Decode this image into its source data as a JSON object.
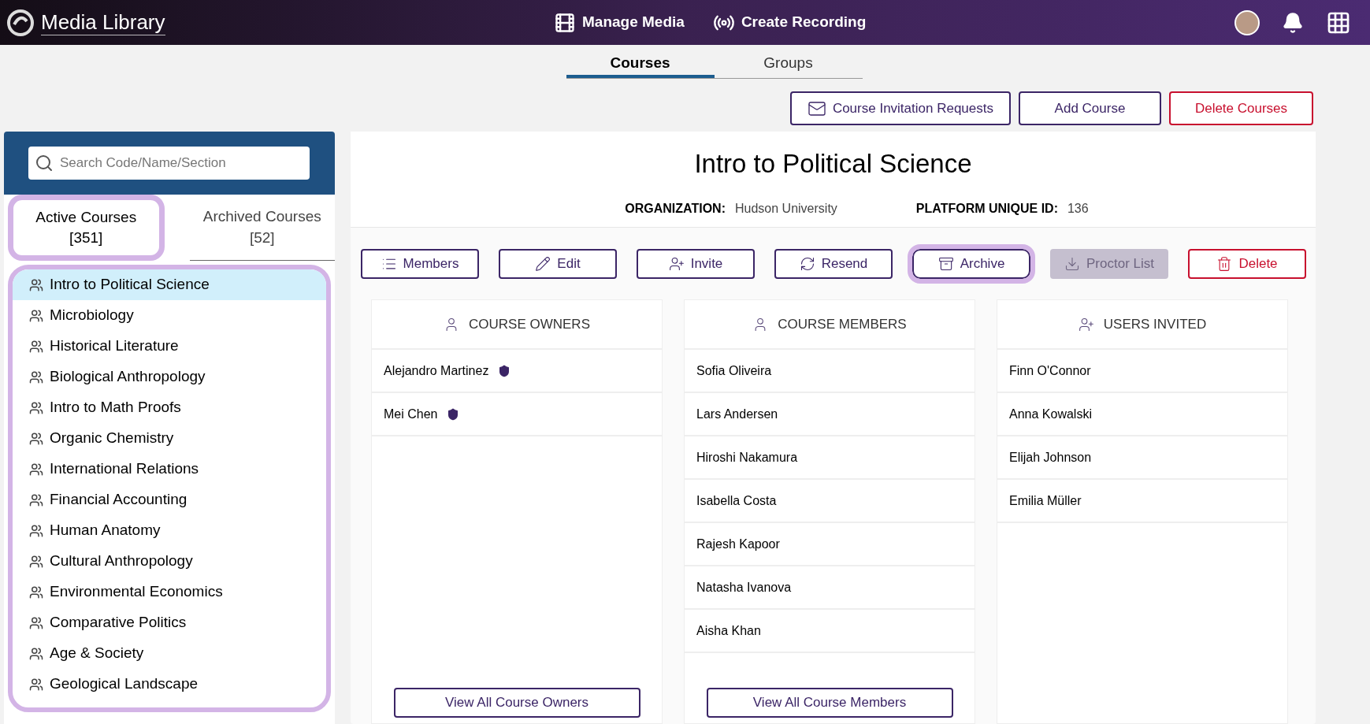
{
  "topbar": {
    "title": "Media Library",
    "nav": [
      {
        "label": "Manage Media",
        "kind": "media"
      },
      {
        "label": "Create Recording",
        "kind": "recording"
      }
    ]
  },
  "tabs": [
    {
      "label": "Courses",
      "selected": true
    },
    {
      "label": "Groups",
      "selected": false
    }
  ],
  "actions": [
    {
      "label": "Course Invitation Requests",
      "kind": "invite"
    },
    {
      "label": "Add Course",
      "kind": "plain"
    },
    {
      "label": "Delete Courses",
      "kind": "danger"
    }
  ],
  "sidebar": {
    "search": {
      "placeholder": "Search Code/Name/Section"
    },
    "tabs": [
      {
        "label": "Active Courses",
        "count": "[351]",
        "selected": true,
        "highlighted": true
      },
      {
        "label": "Archived Courses",
        "count": "[52]",
        "selected": false,
        "highlighted": false
      }
    ],
    "list_highlighted": true,
    "courses": [
      {
        "name": "Intro to Political Science",
        "selected": true
      },
      {
        "name": "Microbiology",
        "selected": false
      },
      {
        "name": "Historical Literature",
        "selected": false
      },
      {
        "name": "Biological Anthropology",
        "selected": false
      },
      {
        "name": "Intro to Math Proofs",
        "selected": false
      },
      {
        "name": "Organic Chemistry",
        "selected": false
      },
      {
        "name": "International Relations",
        "selected": false
      },
      {
        "name": "Financial Accounting",
        "selected": false
      },
      {
        "name": "Human Anatomy",
        "selected": false
      },
      {
        "name": "Cultural Anthropology",
        "selected": false
      },
      {
        "name": "Environmental Economics",
        "selected": false
      },
      {
        "name": "Comparative Politics",
        "selected": false
      },
      {
        "name": "Age & Society",
        "selected": false
      },
      {
        "name": "Geological Landscape",
        "selected": false
      }
    ]
  },
  "course": {
    "title": "Intro to Political Science",
    "organization_label": "ORGANIZATION:",
    "organization": "Hudson University",
    "platform_id_label": "PLATFORM UNIQUE ID:",
    "platform_id": "136",
    "buttons": [
      {
        "label": "Members",
        "kind": "list",
        "disabled": false,
        "highlighted": false
      },
      {
        "label": "Edit",
        "kind": "edit",
        "disabled": false,
        "highlighted": false
      },
      {
        "label": "Invite",
        "kind": "invite",
        "disabled": false,
        "highlighted": false
      },
      {
        "label": "Resend",
        "kind": "resend",
        "disabled": false,
        "highlighted": false
      },
      {
        "label": "Archive",
        "kind": "archive",
        "disabled": false,
        "highlighted": true
      },
      {
        "label": "Proctor List",
        "kind": "download",
        "disabled": true,
        "highlighted": false
      },
      {
        "label": "Delete",
        "kind": "delete",
        "disabled": false,
        "highlighted": false
      }
    ],
    "columns": [
      {
        "heading": "COURSE OWNERS",
        "kind": "owner",
        "people": [
          {
            "name": "Alejandro Martinez",
            "shield": true
          },
          {
            "name": "Mei Chen",
            "shield": true
          }
        ],
        "view_all": "View All Course Owners"
      },
      {
        "heading": "COURSE MEMBERS",
        "kind": "member",
        "people": [
          {
            "name": "Sofia Oliveira",
            "shield": false
          },
          {
            "name": "Lars Andersen",
            "shield": false
          },
          {
            "name": "Hiroshi Nakamura",
            "shield": false
          },
          {
            "name": "Isabella Costa",
            "shield": false
          },
          {
            "name": "Rajesh Kapoor",
            "shield": false
          },
          {
            "name": "Natasha Ivanova",
            "shield": false
          },
          {
            "name": "Aisha Khan",
            "shield": false
          }
        ],
        "view_all": "View All Course Members"
      },
      {
        "heading": "USERS INVITED",
        "kind": "invited",
        "people": [
          {
            "name": "Finn O'Connor",
            "shield": false
          },
          {
            "name": "Anna Kowalski",
            "shield": false
          },
          {
            "name": "Elijah Johnson",
            "shield": false
          },
          {
            "name": "Emilia Müller",
            "shield": false
          }
        ]
      }
    ]
  }
}
